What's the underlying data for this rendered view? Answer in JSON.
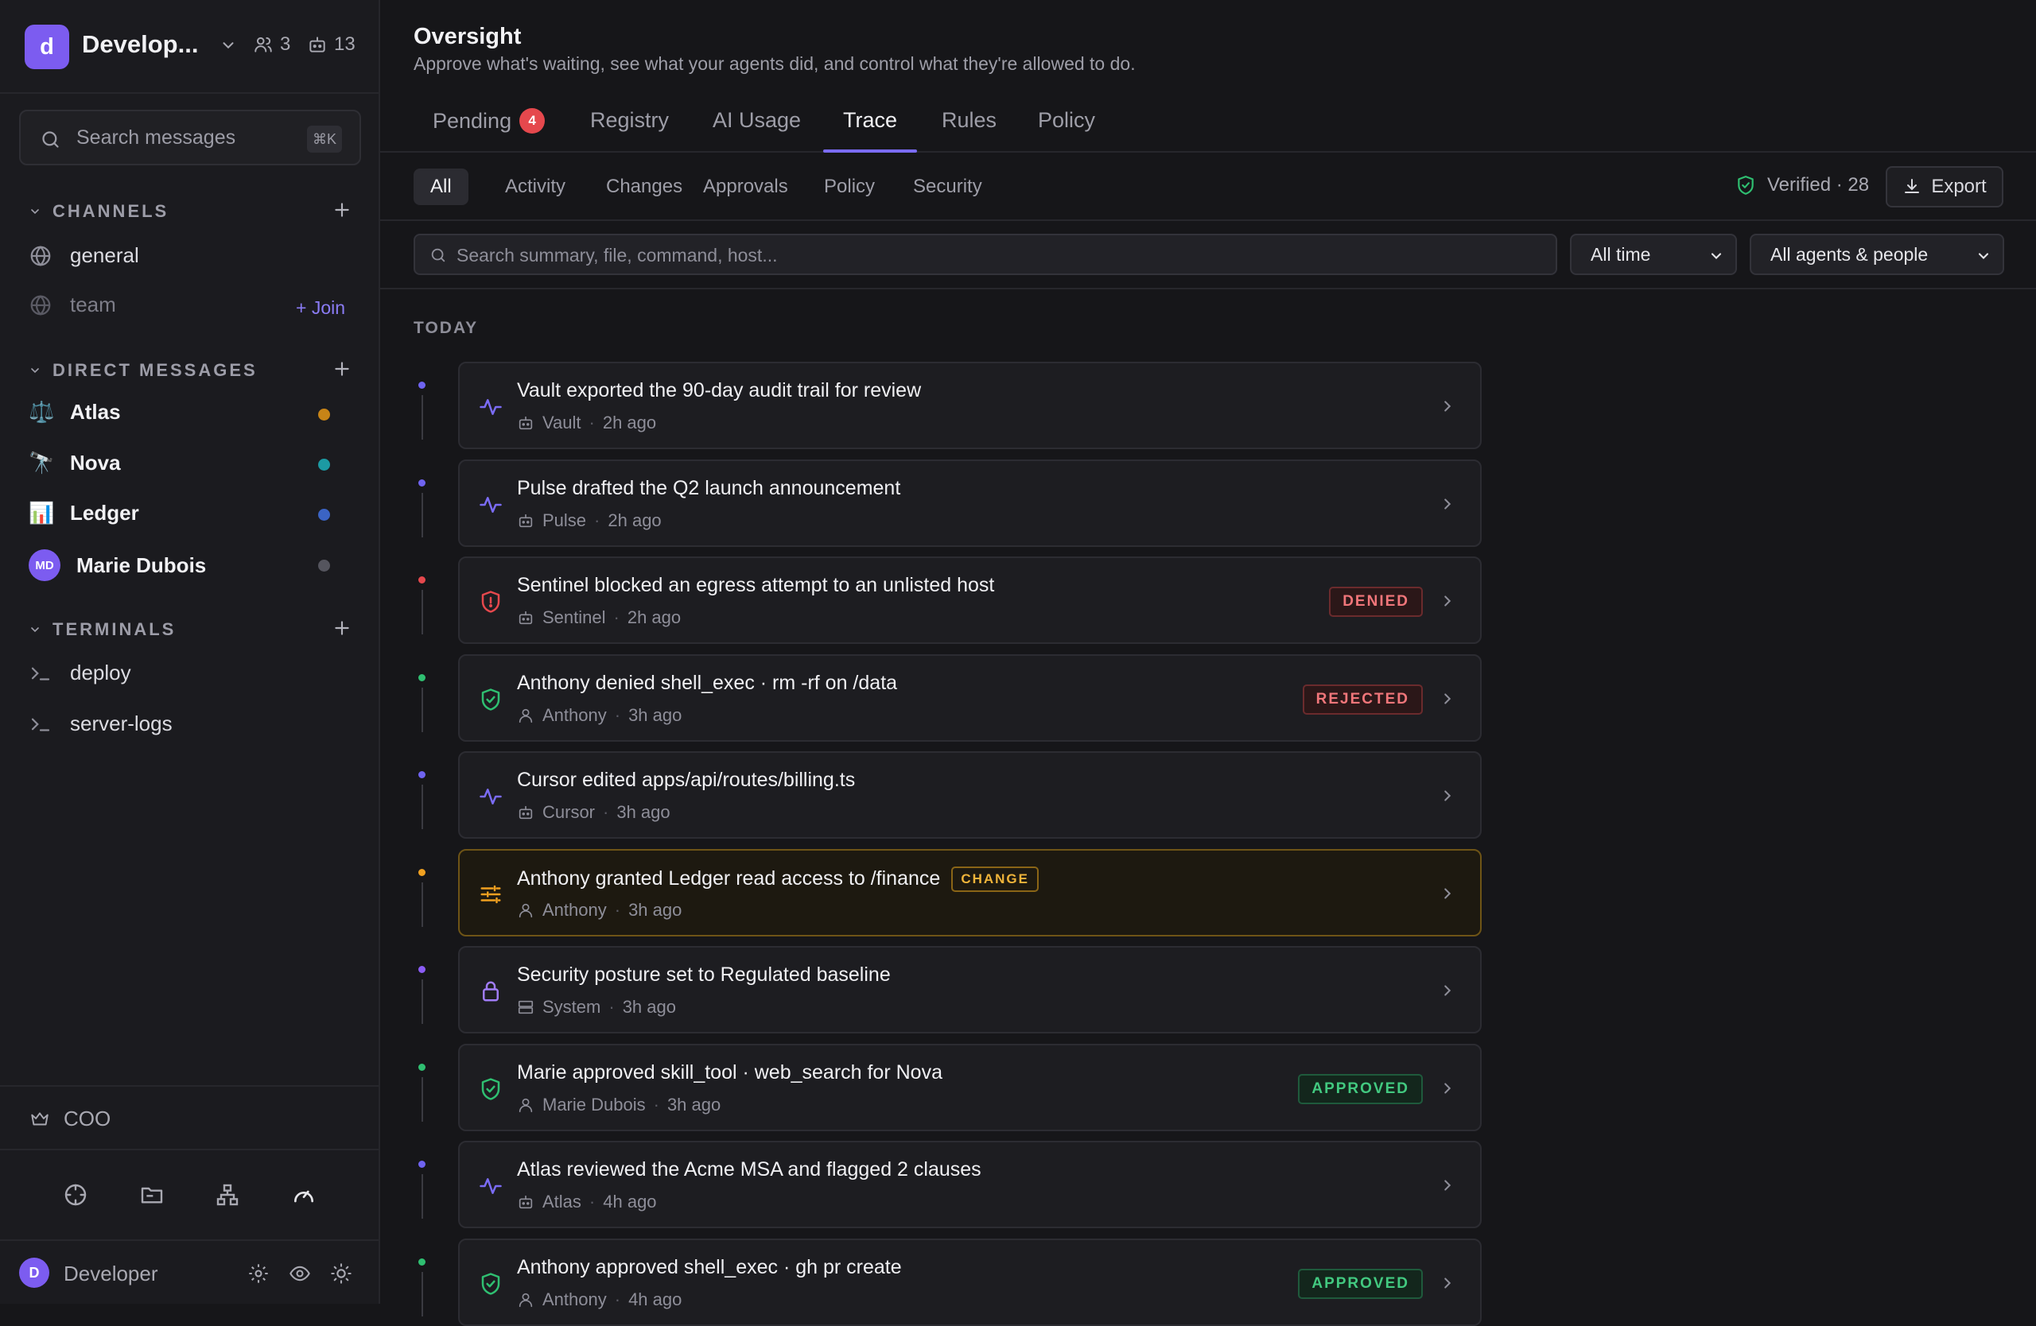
{
  "workspace": {
    "initial": "d",
    "name": "Develop...",
    "members": "3",
    "agents": "13"
  },
  "search": {
    "placeholder": "Search messages",
    "shortcut": "⌘K"
  },
  "channels": {
    "title": "CHANNELS",
    "items": [
      {
        "label": "general"
      },
      {
        "label": "team",
        "action": "+ Join"
      }
    ]
  },
  "direct_messages": {
    "title": "DIRECT MESSAGES",
    "items": [
      {
        "label": "Atlas",
        "icon": "⚖️",
        "status_color": "#c78417"
      },
      {
        "label": "Nova",
        "icon": "🔭",
        "status_color": "#1c9aa3"
      },
      {
        "label": "Ledger",
        "icon": "📊",
        "status_color": "#3b64c4"
      },
      {
        "label": "Marie Dubois",
        "initials": "MD",
        "status_color": "#55555e"
      }
    ]
  },
  "terminals": {
    "title": "TERMINALS",
    "items": [
      {
        "label": "deploy"
      },
      {
        "label": "server-logs"
      }
    ]
  },
  "role": {
    "label": "COO"
  },
  "user": {
    "initial": "D",
    "name": "Developer"
  },
  "header": {
    "title": "Oversight",
    "subtitle": "Approve what's waiting, see what your agents did, and control what they're allowed to do."
  },
  "tabs": [
    {
      "label": "Pending",
      "badge": "4"
    },
    {
      "label": "Registry"
    },
    {
      "label": "AI Usage"
    },
    {
      "label": "Trace",
      "active": true
    },
    {
      "label": "Rules"
    },
    {
      "label": "Policy"
    }
  ],
  "subtabs": [
    {
      "label": "All",
      "active": true
    },
    {
      "label": "Activity"
    },
    {
      "label": "Changes"
    },
    {
      "label": "Approvals"
    },
    {
      "label": "Policy"
    },
    {
      "label": "Security"
    }
  ],
  "verified": "Verified · 28",
  "export_label": "Export",
  "filter": {
    "placeholder": "Search summary, file, command, host...",
    "time": "All time",
    "actors": "All agents & people"
  },
  "group_label": "TODAY",
  "events": [
    {
      "title": "Vault exported the 90-day audit trail for review",
      "actor": "Vault",
      "actor_type": "agent",
      "time": "2h ago",
      "icon": "activity-icon",
      "dot": "#6f63f0"
    },
    {
      "title": "Pulse drafted the Q2 launch announcement",
      "actor": "Pulse",
      "actor_type": "agent",
      "time": "2h ago",
      "icon": "activity-icon",
      "dot": "#6f63f0"
    },
    {
      "title": "Sentinel blocked an egress attempt to an unlisted host",
      "actor": "Sentinel",
      "actor_type": "agent",
      "time": "2h ago",
      "icon": "shield-alert-icon",
      "dot": "#e5484d",
      "status": "DENIED",
      "status_kind": "denied"
    },
    {
      "title": "Anthony denied shell_exec · rm -rf on /data",
      "actor": "Anthony",
      "actor_type": "person",
      "time": "3h ago",
      "icon": "shield-check-icon",
      "dot": "#2fbf71",
      "status": "REJECTED",
      "status_kind": "denied"
    },
    {
      "title": "Cursor edited apps/api/routes/billing.ts",
      "actor": "Cursor",
      "actor_type": "agent",
      "time": "3h ago",
      "icon": "activity-icon",
      "dot": "#6f63f0"
    },
    {
      "title": "Anthony granted Ledger read access to /finance",
      "tag": "CHANGE",
      "actor": "Anthony",
      "actor_type": "person",
      "time": "3h ago",
      "icon": "sliders-icon",
      "dot": "#f0a020",
      "highlight": true
    },
    {
      "title": "Security posture set to Regulated baseline",
      "actor": "System",
      "actor_type": "system",
      "time": "3h ago",
      "icon": "lock-icon",
      "dot": "#8b5cf6"
    },
    {
      "title": "Marie approved skill_tool · web_search for Nova",
      "actor": "Marie Dubois",
      "actor_type": "person",
      "time": "3h ago",
      "icon": "shield-check-icon",
      "dot": "#2fbf71",
      "status": "APPROVED",
      "status_kind": "approved"
    },
    {
      "title": "Atlas reviewed the Acme MSA and flagged 2 clauses",
      "actor": "Atlas",
      "actor_type": "agent",
      "time": "4h ago",
      "icon": "activity-icon",
      "dot": "#6f63f0"
    },
    {
      "title": "Anthony approved shell_exec · gh pr create",
      "actor": "Anthony",
      "actor_type": "person",
      "time": "4h ago",
      "icon": "shield-check-icon",
      "dot": "#2fbf71",
      "status": "APPROVED",
      "status_kind": "approved"
    }
  ]
}
